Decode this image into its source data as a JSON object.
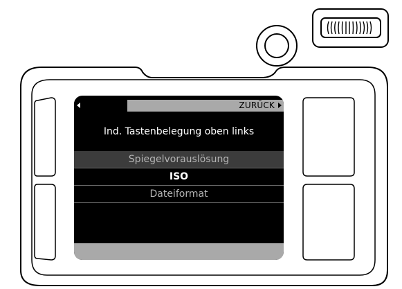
{
  "header": {
    "back_label": "ZURÜCK"
  },
  "screen": {
    "title": "Ind. Tastenbelegung oben links"
  },
  "menu": {
    "items": [
      {
        "label": "Spiegelvorauslösung",
        "state": "dimmed"
      },
      {
        "label": "ISO",
        "state": "selected"
      },
      {
        "label": "Dateiformat",
        "state": "normal"
      }
    ]
  },
  "icons": {
    "top_dial": "thumbwheel-icon",
    "round_button": "round-button-icon",
    "back_arrow": "triangle-left-icon",
    "forward_arrow": "triangle-right-icon"
  },
  "colors": {
    "screen_background": "#000000",
    "bar_grey": "#a9a9a9",
    "dimmed_row": "#3c3c3c",
    "dimmed_text": "#b4b4b4",
    "selected_text": "#ffffff"
  }
}
